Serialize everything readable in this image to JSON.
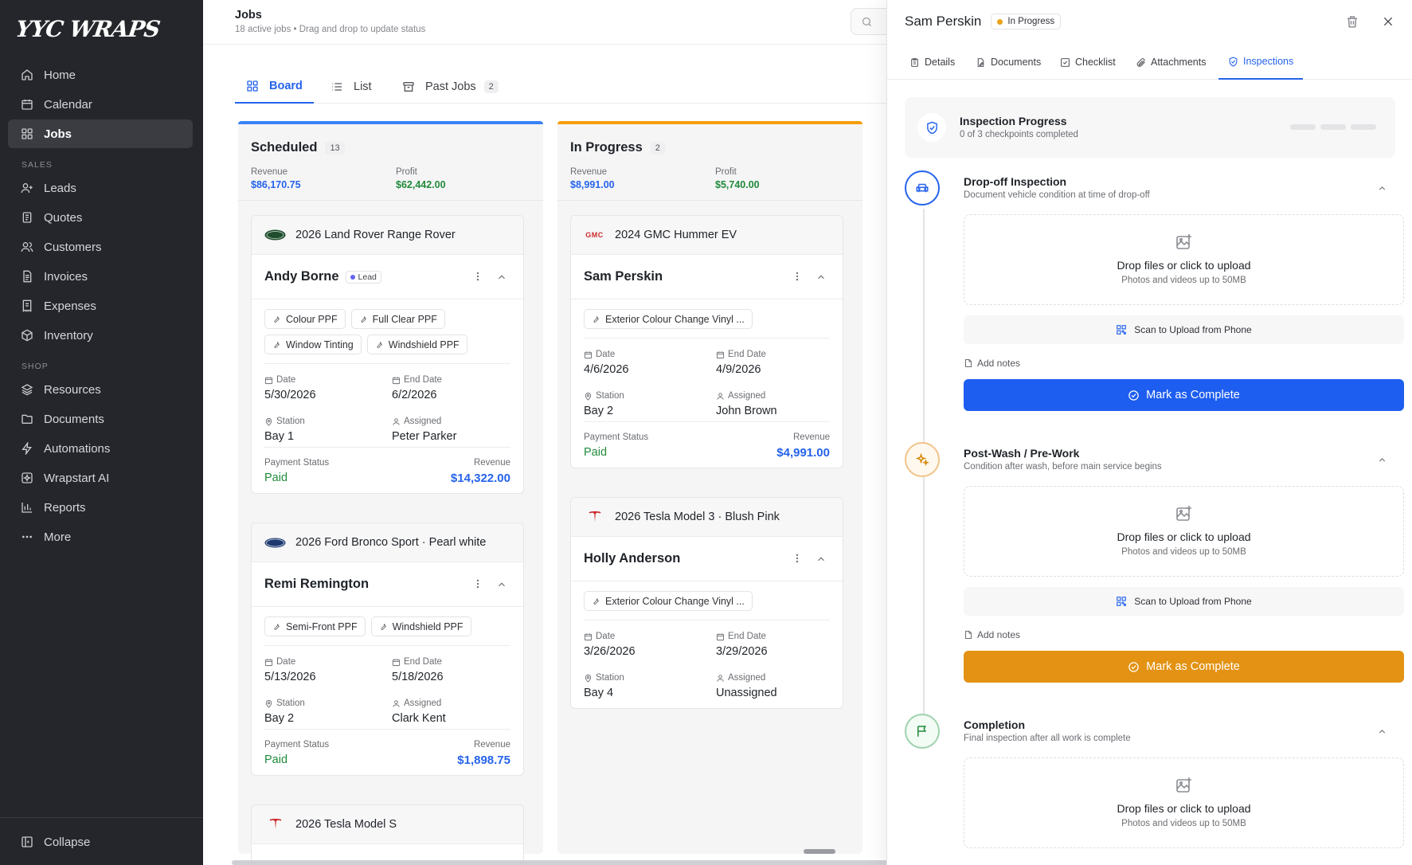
{
  "app": {
    "logo": "YYC WRAPS"
  },
  "sidebar": {
    "items_main": [
      {
        "label": "Home",
        "icon": "home-icon"
      },
      {
        "label": "Calendar",
        "icon": "calendar-icon"
      },
      {
        "label": "Jobs",
        "icon": "grid-icon",
        "active": true
      }
    ],
    "section_sales": "SALES",
    "items_sales": [
      {
        "label": "Leads",
        "icon": "user-plus-icon"
      },
      {
        "label": "Quotes",
        "icon": "document-icon"
      },
      {
        "label": "Customers",
        "icon": "users-icon"
      },
      {
        "label": "Invoices",
        "icon": "invoice-icon"
      },
      {
        "label": "Expenses",
        "icon": "receipt-icon"
      },
      {
        "label": "Inventory",
        "icon": "box-icon"
      }
    ],
    "section_shop": "SHOP",
    "items_shop": [
      {
        "label": "Resources",
        "icon": "layers-icon"
      },
      {
        "label": "Documents",
        "icon": "folder-icon"
      },
      {
        "label": "Automations",
        "icon": "bolt-icon"
      },
      {
        "label": "Wrapstart AI",
        "icon": "sparkle-box-icon"
      },
      {
        "label": "Reports",
        "icon": "bar-chart-icon"
      },
      {
        "label": "More",
        "icon": "more-icon"
      }
    ],
    "collapse_label": "Collapse"
  },
  "header": {
    "title": "Jobs",
    "subtitle": "18 active jobs • Drag and drop to update status"
  },
  "view_tabs": {
    "board": "Board",
    "list": "List",
    "past_jobs": "Past Jobs",
    "past_jobs_count": "2"
  },
  "columns": {
    "scheduled": {
      "title": "Scheduled",
      "count": "13",
      "revenue_label": "Revenue",
      "revenue": "$86,170.75",
      "profit_label": "Profit",
      "profit": "$62,442.00",
      "accent": "#3b82f6"
    },
    "in_progress": {
      "title": "In Progress",
      "count": "2",
      "revenue_label": "Revenue",
      "revenue": "$8,991.00",
      "profit_label": "Profit",
      "profit": "$5,740.00",
      "accent": "#f59e0b"
    }
  },
  "labels": {
    "date": "Date",
    "end_date": "End Date",
    "station": "Station",
    "assigned": "Assigned",
    "payment_status": "Payment Status",
    "revenue": "Revenue",
    "lead": "Lead"
  },
  "cards": {
    "c1": {
      "vehicle": "2026 Land Rover Range Rover",
      "customer": "Andy Borne",
      "services": [
        "Colour PPF",
        "Full Clear PPF",
        "Window Tinting",
        "Windshield PPF"
      ],
      "date": "5/30/2026",
      "end_date": "6/2/2026",
      "station": "Bay 1",
      "assigned": "Peter Parker",
      "payment": "Paid",
      "revenue": "$14,322.00"
    },
    "c2": {
      "vehicle": "2026 Ford Bronco Sport · Pearl white",
      "customer": "Remi Remington",
      "services": [
        "Semi-Front PPF",
        "Windshield PPF"
      ],
      "date": "5/13/2026",
      "end_date": "5/18/2026",
      "station": "Bay 2",
      "assigned": "Clark Kent",
      "payment": "Paid",
      "revenue": "$1,898.75"
    },
    "c3": {
      "vehicle": "2026 Tesla Model S"
    },
    "c4": {
      "vehicle": "2024 GMC Hummer EV",
      "brand_text": "GMC",
      "customer": "Sam Perskin",
      "services": [
        "Exterior Colour Change Vinyl ..."
      ],
      "date": "4/6/2026",
      "end_date": "4/9/2026",
      "station": "Bay 2",
      "assigned": "John Brown",
      "payment": "Paid",
      "revenue": "$4,991.00"
    },
    "c5": {
      "vehicle": "2026 Tesla Model 3 · Blush Pink",
      "customer": "Holly Anderson",
      "services": [
        "Exterior Colour Change Vinyl ..."
      ],
      "date": "3/26/2026",
      "end_date": "3/29/2026",
      "station": "Bay 4",
      "assigned": "Unassigned"
    }
  },
  "panel": {
    "title": "Sam Perskin",
    "status": "In Progress",
    "tabs": [
      "Details",
      "Documents",
      "Checklist",
      "Attachments",
      "Inspections"
    ],
    "progress_title": "Inspection Progress",
    "progress_sub": "0 of 3 checkpoints completed",
    "progress_value": 0,
    "dropzone_title": "Drop files or click to upload",
    "dropzone_sub": "Photos and videos up to 50MB",
    "scan_label": "Scan to Upload from Phone",
    "add_notes": "Add notes",
    "mark_complete": "Mark as Complete",
    "sections": {
      "dropoff": {
        "title": "Drop-off Inspection",
        "sub": "Document vehicle condition at time of drop-off",
        "color": "#2563eb"
      },
      "postwash": {
        "title": "Post-Wash / Pre-Work",
        "sub": "Condition after wash, before main service begins",
        "color": "#e39213"
      },
      "completion": {
        "title": "Completion",
        "sub": "Final inspection after all work is complete",
        "color": "#1f8a3a"
      }
    }
  }
}
